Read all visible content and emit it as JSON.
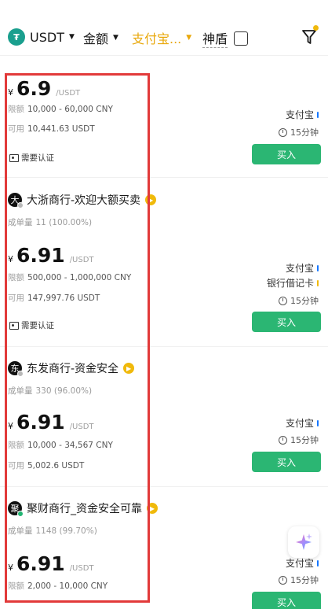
{
  "filters": {
    "coin": "USDT",
    "amount": "金额",
    "payment": "支付宝...",
    "shield": "神盾"
  },
  "listings": [
    {
      "merchant": "",
      "orders_label": "",
      "orders_value": "",
      "currency_symbol": "¥",
      "price": "6.9",
      "price_unit": "/USDT",
      "limit_label": "限额",
      "limit_value": "10,000 - 60,000 CNY",
      "available_label": "可用",
      "available_value": "10,441.63 USDT",
      "verification": "需要认证",
      "payments": [
        "支付宝"
      ],
      "time": "15分钟",
      "action": "买入"
    },
    {
      "avatar_char": "大",
      "merchant": "大浙商行-欢迎大额买卖",
      "orders_label": "成单量",
      "orders_value": "11 (100.00%)",
      "currency_symbol": "¥",
      "price": "6.91",
      "price_unit": "/USDT",
      "limit_label": "限额",
      "limit_value": "500,000 - 1,000,000 CNY",
      "available_label": "可用",
      "available_value": "147,997.76 USDT",
      "verification": "需要认证",
      "payments": [
        "支付宝",
        "银行借记卡"
      ],
      "time": "15分钟",
      "action": "买入"
    },
    {
      "avatar_char": "东",
      "merchant": "东发商行-资金安全",
      "orders_label": "成单量",
      "orders_value": "330 (96.00%)",
      "currency_symbol": "¥",
      "price": "6.91",
      "price_unit": "/USDT",
      "limit_label": "限额",
      "limit_value": "10,000 - 34,567 CNY",
      "available_label": "可用",
      "available_value": "5,002.6 USDT",
      "payments": [
        "支付宝"
      ],
      "time": "15分钟",
      "action": "买入"
    },
    {
      "avatar_char": "聚",
      "merchant": "聚财商行_资金安全可靠",
      "orders_label": "成单量",
      "orders_value": "1148 (99.70%)",
      "currency_symbol": "¥",
      "price": "6.91",
      "price_unit": "/USDT",
      "limit_label": "限额",
      "limit_value": "2,000 - 10,000 CNY",
      "payments": [
        "支付宝"
      ],
      "time": "15分钟",
      "action": "买入"
    }
  ],
  "colors": {
    "accent": "#e9a80b",
    "buy_button": "#2bb673",
    "annotation_frame": "#e23a3a"
  }
}
